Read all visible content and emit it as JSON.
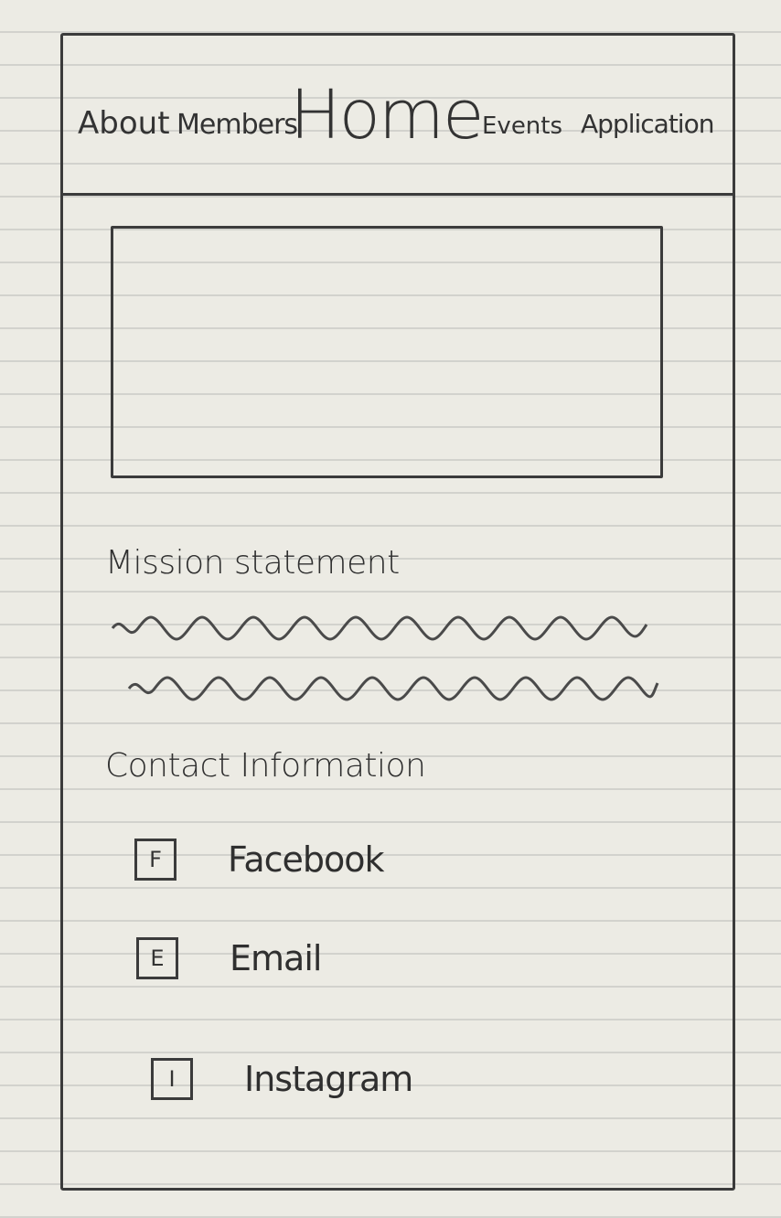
{
  "nav": {
    "about": "About",
    "members": "Members",
    "home": "Home",
    "events": "Events",
    "application": "Application"
  },
  "mission": {
    "heading": "Mission statement"
  },
  "contact": {
    "heading": "Contact Information",
    "items": [
      {
        "icon_letter": "F",
        "icon": "facebook-icon",
        "label": "Facebook"
      },
      {
        "icon_letter": "E",
        "icon": "email-icon",
        "label": "Email"
      },
      {
        "icon_letter": "I",
        "icon": "instagram-icon",
        "label": "Instagram"
      }
    ]
  }
}
